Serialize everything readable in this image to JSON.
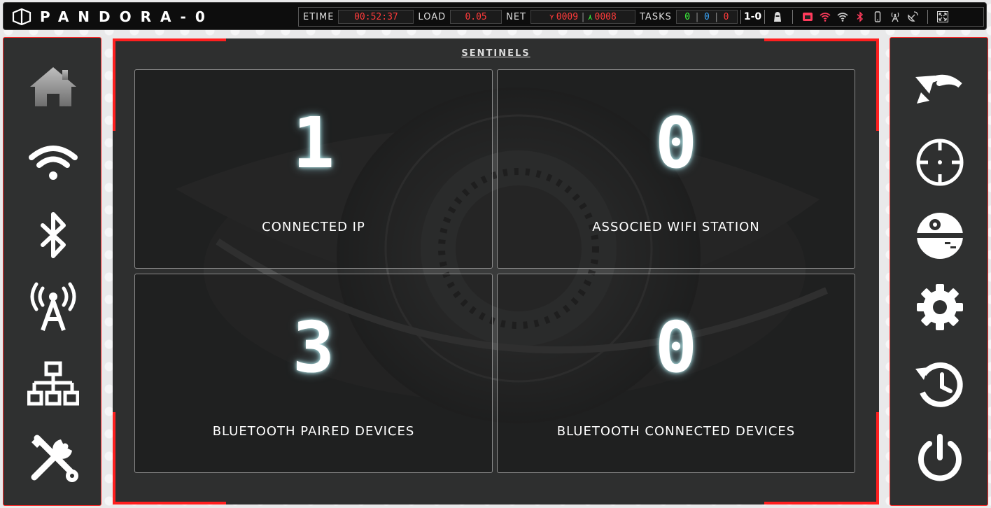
{
  "app": {
    "title": "PANDORA-0"
  },
  "status": {
    "etime_label": "ETIME",
    "etime_value": "00:52:37",
    "load_label": "LOAD",
    "load_value": "0.05",
    "net_label": "NET",
    "net_down": "0009",
    "net_separator": "|",
    "net_up": "0008",
    "tasks_label": "TASKS",
    "tasks_green": "0",
    "tasks_blue": "0",
    "tasks_red": "0",
    "mode": "1-0",
    "icons": [
      "hacker-icon",
      "ethernet-icon",
      "wifi-icon",
      "wifi-icon",
      "bluetooth-icon",
      "mobile-icon",
      "antenna-icon",
      "satellite-dish-icon",
      "fullscreen-icon"
    ],
    "colors": {
      "red": "#ff3b3b",
      "green": "#3cff3c",
      "blue": "#3aa8ff"
    }
  },
  "sidebar_left": [
    "home-icon",
    "wifi-icon",
    "bluetooth-icon",
    "broadcast-tower-icon",
    "network-icon",
    "tools-icon"
  ],
  "sidebar_right": [
    "undo-icon",
    "crosshairs-icon",
    "death-star-icon",
    "gear-icon",
    "history-icon",
    "power-icon"
  ],
  "main": {
    "title": "SENTINELS",
    "cards": [
      {
        "value": "1",
        "label": "CONNECTED IP"
      },
      {
        "value": "0",
        "label": "ASSOCIED WIFI STATION"
      },
      {
        "value": "3",
        "label": "BLUETOOTH PAIRED DEVICES"
      },
      {
        "value": "0",
        "label": "BLUETOOTH CONNECTED DEVICES"
      }
    ]
  },
  "colors": {
    "accent": "#ff1f1f",
    "panel": "#2e2f2f",
    "sidebar": "#2f3030"
  }
}
